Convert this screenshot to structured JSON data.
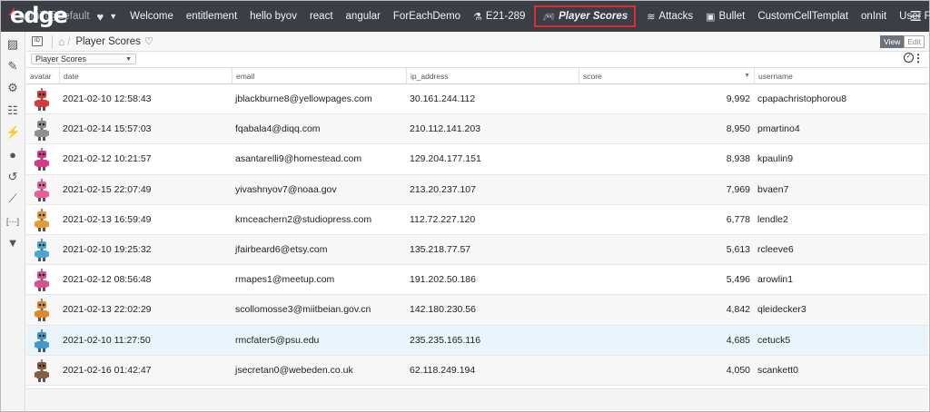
{
  "app": {
    "logo_text": "edge",
    "user": "admin@default"
  },
  "nav": {
    "items": [
      {
        "label": "Welcome",
        "icon": ""
      },
      {
        "label": "entitlement",
        "icon": ""
      },
      {
        "label": "hello byov",
        "icon": ""
      },
      {
        "label": "react",
        "icon": ""
      },
      {
        "label": "angular",
        "icon": ""
      },
      {
        "label": "ForEachDemo",
        "icon": ""
      },
      {
        "label": "E21-289",
        "icon": "flask-icon"
      },
      {
        "label": "Player Scores",
        "icon": "gamepad-icon",
        "active": true
      },
      {
        "label": "Attacks",
        "icon": "wifi-icon"
      },
      {
        "label": "Bullet",
        "icon": "tag-icon"
      },
      {
        "label": "CustomCellTemplat",
        "icon": ""
      },
      {
        "label": "onInit",
        "icon": ""
      },
      {
        "label": "User Form",
        "icon": ""
      }
    ]
  },
  "breadcrumb": {
    "title": "Player Scores"
  },
  "view_toggle": {
    "view": "View",
    "edit": "Edit"
  },
  "selector": {
    "value": "Player Scores"
  },
  "grid": {
    "columns": [
      "avatar",
      "date",
      "email",
      "ip_address",
      "score",
      "username"
    ],
    "sorted_column": "score",
    "sort_direction": "desc",
    "rows": [
      {
        "avatar_color": "#d83a3a",
        "date": "2021-02-10 12:58:43",
        "email": "jblackburne8@yellowpages.com",
        "ip_address": "30.161.244.112",
        "score": "9,992",
        "username": "cpapachristophorou8"
      },
      {
        "avatar_color": "#8f8f8f",
        "date": "2021-02-14 15:57:03",
        "email": "fqabala4@diqq.com",
        "ip_address": "210.112.141.203",
        "score": "8,950",
        "username": "pmartino4"
      },
      {
        "avatar_color": "#d9378a",
        "date": "2021-02-12 10:21:57",
        "email": "asantarelli9@homestead.com",
        "ip_address": "129.204.177.151",
        "score": "8,938",
        "username": "kpaulin9"
      },
      {
        "avatar_color": "#e8609a",
        "date": "2021-02-15 22:07:49",
        "email": "yivashnyov7@noaa.gov",
        "ip_address": "213.20.237.107",
        "score": "7,969",
        "username": "bvaen7"
      },
      {
        "avatar_color": "#e89a2e",
        "date": "2021-02-13 16:59:49",
        "email": "kmceachern2@studiopress.com",
        "ip_address": "112.72.227.120",
        "score": "6,778",
        "username": "lendle2"
      },
      {
        "avatar_color": "#4aa6d6",
        "date": "2021-02-10 19:25:32",
        "email": "jfairbeard6@etsy.com",
        "ip_address": "135.218.77.57",
        "score": "5,613",
        "username": "rcleeve6"
      },
      {
        "avatar_color": "#d94f8f",
        "date": "2021-02-12 08:56:48",
        "email": "rmapes1@meetup.com",
        "ip_address": "191.202.50.186",
        "score": "5,496",
        "username": "arowlin1"
      },
      {
        "avatar_color": "#e0892a",
        "date": "2021-02-13 22:02:29",
        "email": "scollomosse3@miitbeian.gov.cn",
        "ip_address": "142.180.230.56",
        "score": "4,842",
        "username": "qleidecker3"
      },
      {
        "avatar_color": "#3d9ad1",
        "date": "2021-02-10 11:27:50",
        "email": "rmcfater5@psu.edu",
        "ip_address": "235.235.165.116",
        "score": "4,685",
        "username": "cetuck5"
      },
      {
        "avatar_color": "#8a5a3c",
        "date": "2021-02-16 01:42:47",
        "email": "jsecretan0@webeden.co.uk",
        "ip_address": "62.118.249.194",
        "score": "4,050",
        "username": "scankett0"
      }
    ],
    "highlighted_row": 8
  },
  "sidebar": {
    "icons": [
      "image-icon",
      "edit-image-icon",
      "file-settings-icon",
      "database-settings-icon",
      "plug-icon",
      "user-icon",
      "history-icon",
      "ruler-icon",
      "code-icon",
      "filter-icon"
    ]
  }
}
